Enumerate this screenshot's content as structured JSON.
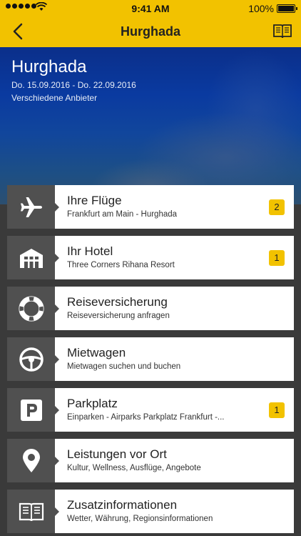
{
  "status": {
    "time": "9:41 AM",
    "battery": "100%"
  },
  "nav": {
    "title": "Hurghada"
  },
  "hero": {
    "title": "Hurghada",
    "dates": "Do. 15.09.2016 - Do. 22.09.2016",
    "provider": "Verschiedene Anbieter"
  },
  "items": [
    {
      "title": "Ihre Flüge",
      "subtitle": "Frankfurt am Main - Hurghada",
      "badge": "2",
      "icon": "airplane-icon"
    },
    {
      "title": "Ihr Hotel",
      "subtitle": "Three Corners Rihana Resort",
      "badge": "1",
      "icon": "hotel-icon"
    },
    {
      "title": "Reiseversicherung",
      "subtitle": "Reiseversicherung anfragen",
      "badge": "",
      "icon": "lifebuoy-icon"
    },
    {
      "title": "Mietwagen",
      "subtitle": "Mietwagen suchen und buchen",
      "badge": "",
      "icon": "steering-wheel-icon"
    },
    {
      "title": "Parkplatz",
      "subtitle": "Einparken - Airparks Parkplatz Frankfurt -...",
      "badge": "1",
      "icon": "parking-icon"
    },
    {
      "title": "Leistungen vor Ort",
      "subtitle": "Kultur, Wellness, Ausflüge, Angebote",
      "badge": "",
      "icon": "location-pin-icon"
    },
    {
      "title": "Zusatzinformationen",
      "subtitle": "Wetter, Währung, Regionsinformationen",
      "badge": "",
      "icon": "book-icon"
    }
  ]
}
